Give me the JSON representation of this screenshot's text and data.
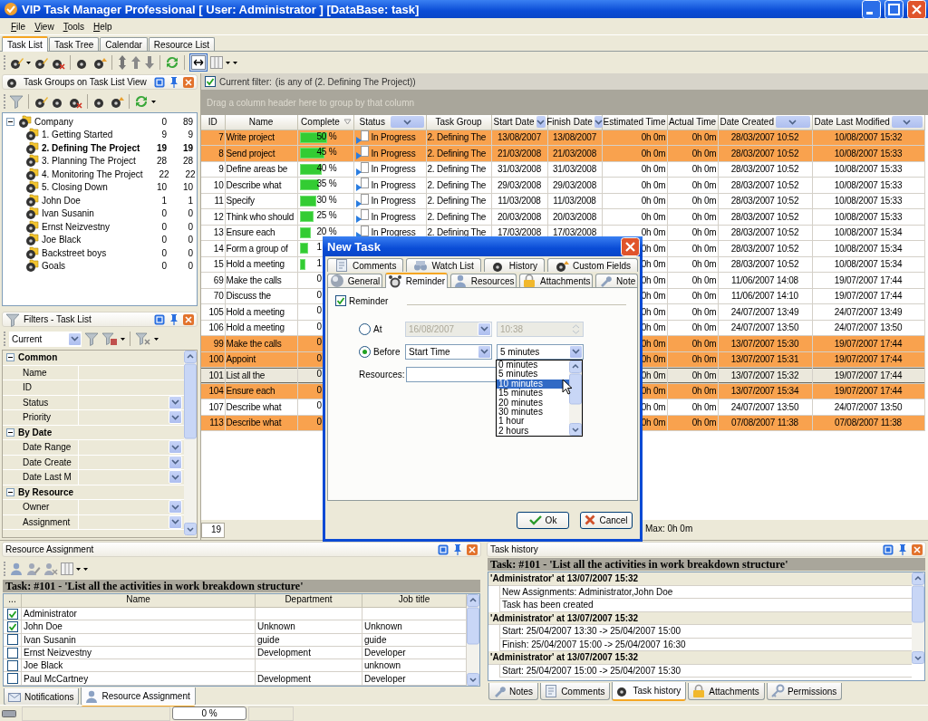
{
  "window": {
    "title": "VIP Task Manager Professional [ User: Administrator ] [DataBase: task]"
  },
  "menu": [
    "File",
    "View",
    "Tools",
    "Help"
  ],
  "tabs": [
    {
      "label": "Task List",
      "selected": true
    },
    {
      "label": "Task Tree",
      "selected": false
    },
    {
      "label": "Calendar",
      "selected": false
    },
    {
      "label": "Resource List",
      "selected": false
    }
  ],
  "task_groups": {
    "title": "Task Groups on Task List View",
    "tree": [
      {
        "label": "Company",
        "count_1": "0",
        "count_2": "89",
        "selected": false,
        "expanded": true,
        "children": [
          {
            "label": "1. Getting Started",
            "count_1": "9",
            "count_2": "9",
            "selected": false
          },
          {
            "label": "2. Defining The Project",
            "count_1": "19",
            "count_2": "19",
            "selected": true
          },
          {
            "label": "3. Planning The Project",
            "count_1": "28",
            "count_2": "28",
            "selected": false
          },
          {
            "label": "4. Monitoring The Project",
            "count_1": "22",
            "count_2": "22",
            "selected": false
          },
          {
            "label": "5. Closing Down",
            "count_1": "10",
            "count_2": "10",
            "selected": false
          },
          {
            "label": "John Doe",
            "count_1": "1",
            "count_2": "1",
            "selected": false
          },
          {
            "label": "Ivan Susanin",
            "count_1": "0",
            "count_2": "0",
            "selected": false
          },
          {
            "label": "Ernst Neizvestny",
            "count_1": "0",
            "count_2": "0",
            "selected": false
          },
          {
            "label": "Joe Black",
            "count_1": "0",
            "count_2": "0",
            "selected": false
          },
          {
            "label": "Backstreet boys",
            "count_1": "0",
            "count_2": "0",
            "selected": false
          },
          {
            "label": "Goals",
            "count_1": "0",
            "count_2": "0",
            "selected": false
          }
        ]
      }
    ]
  },
  "filters": {
    "title": "Filters - Task List",
    "preset": "Current",
    "categories": [
      {
        "label": "Common",
        "expanded": true,
        "fields": [
          {
            "label": "Name",
            "kind": "text"
          },
          {
            "label": "ID",
            "kind": "text"
          },
          {
            "label": "Status",
            "kind": "dropdown"
          },
          {
            "label": "Priority",
            "kind": "dropdown"
          }
        ]
      },
      {
        "label": "By Date",
        "expanded": true,
        "fields": [
          {
            "label": "Date Range",
            "kind": "dropdown"
          },
          {
            "label": "Date Create",
            "kind": "dropdown"
          },
          {
            "label": "Date Last M",
            "kind": "dropdown"
          }
        ]
      },
      {
        "label": "By Resource",
        "expanded": true,
        "fields": [
          {
            "label": "Owner",
            "kind": "dropdown"
          },
          {
            "label": "Assignment",
            "kind": "dropdown"
          }
        ]
      }
    ]
  },
  "task_list": {
    "filter": {
      "checked": true,
      "label": "Current filter:",
      "value": "(is any of (2. Defining The Project))"
    },
    "group_hint": "Drag a column header here to group by that column",
    "columns": [
      {
        "label": "ID",
        "kind": "plain"
      },
      {
        "label": "Name",
        "kind": "plain"
      },
      {
        "label": "Complete",
        "kind": "sort"
      },
      {
        "label": "Status",
        "kind": "dropdown"
      },
      {
        "label": "Task Group",
        "kind": "plain"
      },
      {
        "label": "Start Date",
        "kind": "dropdown"
      },
      {
        "label": "Finish Date",
        "kind": "dropdown"
      },
      {
        "label": "Estimated Time",
        "kind": "plain"
      },
      {
        "label": "Actual Time",
        "kind": "plain"
      },
      {
        "label": "Date Created",
        "kind": "dropdown"
      },
      {
        "label": "Date Last Modified",
        "kind": "dropdown"
      }
    ],
    "rows": [
      {
        "id": "7",
        "name": "Write project",
        "complete": "50 %",
        "level": 0.5,
        "status": "In Progress",
        "task_group": "2. Defining The",
        "start_date": "13/08/2007",
        "finish_date": "13/08/2007",
        "estimated_time": "0h 0m",
        "actual_time": "0h 0m",
        "date_created": "28/03/2007 10:52",
        "date_last_modified": "10/08/2007 15:32",
        "color": "#f9a24e",
        "selected": false
      },
      {
        "id": "8",
        "name": "Send project",
        "complete": "45 %",
        "level": 0.45,
        "status": "In Progress",
        "task_group": "2. Defining The",
        "start_date": "21/03/2008",
        "finish_date": "21/03/2008",
        "estimated_time": "0h 0m",
        "actual_time": "0h 0m",
        "date_created": "28/03/2007 10:52",
        "date_last_modified": "10/08/2007 15:33",
        "color": "#f9a24e",
        "selected": false
      },
      {
        "id": "9",
        "name": "Define areas be",
        "complete": "40 %",
        "level": 0.4,
        "status": "In Progress",
        "task_group": "2. Defining The",
        "start_date": "31/03/2008",
        "finish_date": "31/03/2008",
        "estimated_time": "0h 0m",
        "actual_time": "0h 0m",
        "date_created": "28/03/2007 10:52",
        "date_last_modified": "10/08/2007 15:33",
        "color": "#ffffff",
        "selected": false
      },
      {
        "id": "10",
        "name": "Describe what",
        "complete": "35 %",
        "level": 0.35,
        "status": "In Progress",
        "task_group": "2. Defining The",
        "start_date": "29/03/2008",
        "finish_date": "29/03/2008",
        "estimated_time": "0h 0m",
        "actual_time": "0h 0m",
        "date_created": "28/03/2007 10:52",
        "date_last_modified": "10/08/2007 15:33",
        "color": "#ffffff",
        "selected": false
      },
      {
        "id": "11",
        "name": "Specify",
        "complete": "30 %",
        "level": 0.3,
        "status": "In Progress",
        "task_group": "2. Defining The",
        "start_date": "11/03/2008",
        "finish_date": "11/03/2008",
        "estimated_time": "0h 0m",
        "actual_time": "0h 0m",
        "date_created": "28/03/2007 10:52",
        "date_last_modified": "10/08/2007 15:33",
        "color": "#ffffff",
        "selected": false
      },
      {
        "id": "12",
        "name": "Think who should",
        "complete": "25 %",
        "level": 0.25,
        "status": "In Progress",
        "task_group": "2. Defining The",
        "start_date": "20/03/2008",
        "finish_date": "20/03/2008",
        "estimated_time": "0h 0m",
        "actual_time": "0h 0m",
        "date_created": "28/03/2007 10:52",
        "date_last_modified": "10/08/2007 15:33",
        "color": "#ffffff",
        "selected": false
      },
      {
        "id": "13",
        "name": "Ensure each",
        "complete": "20 %",
        "level": 0.2,
        "status": "In Progress",
        "task_group": "2. Defining The",
        "start_date": "17/03/2008",
        "finish_date": "17/03/2008",
        "estimated_time": "0h 0m",
        "actual_time": "0h 0m",
        "date_created": "28/03/2007 10:52",
        "date_last_modified": "10/08/2007 15:34",
        "color": "#ffffff",
        "selected": false
      },
      {
        "id": "14",
        "name": "Form a group of",
        "complete": "1",
        "level": 0.15,
        "estimated_time": "0h 0m",
        "actual_time": "0h 0m",
        "date_created": "28/03/2007 10:52",
        "date_last_modified": "10/08/2007 15:34",
        "color": "#ffffff",
        "selected": false
      },
      {
        "id": "15",
        "name": "Hold a meeting",
        "complete": "1",
        "level": 0.1,
        "estimated_time": "0h 0m",
        "actual_time": "0h 0m",
        "date_created": "28/03/2007 10:52",
        "date_last_modified": "10/08/2007 15:34",
        "color": "#ffffff",
        "selected": false
      },
      {
        "id": "69",
        "name": "Make the calls",
        "complete": "0",
        "level": 0,
        "estimated_time": "0h 0m",
        "actual_time": "0h 0m",
        "date_created": "11/06/2007 14:08",
        "date_last_modified": "19/07/2007 17:44",
        "color": "#ffffff",
        "selected": false
      },
      {
        "id": "70",
        "name": "Discuss the",
        "complete": "0",
        "level": 0,
        "estimated_time": "0h 0m",
        "actual_time": "0h 0m",
        "date_created": "11/06/2007 14:10",
        "date_last_modified": "19/07/2007 17:44",
        "color": "#ffffff",
        "selected": false
      },
      {
        "id": "105",
        "name": "Hold a meeting",
        "complete": "0",
        "level": 0,
        "estimated_time": "0h 0m",
        "actual_time": "0h 0m",
        "date_created": "24/07/2007 13:49",
        "date_last_modified": "24/07/2007 13:49",
        "color": "#ffffff",
        "selected": false
      },
      {
        "id": "106",
        "name": "Hold a meeting",
        "complete": "0",
        "level": 0,
        "estimated_time": "0h 0m",
        "actual_time": "0h 0m",
        "date_created": "24/07/2007 13:50",
        "date_last_modified": "24/07/2007 13:50",
        "color": "#ffffff",
        "selected": false
      },
      {
        "id": "99",
        "name": "Make the calls",
        "complete": "0",
        "level": 0,
        "estimated_time": "0h 0m",
        "actual_time": "0h 0m",
        "date_created": "13/07/2007 15:30",
        "date_last_modified": "19/07/2007 17:44",
        "color": "#f9a24e",
        "selected": false
      },
      {
        "id": "100",
        "name": "Appoint",
        "complete": "0",
        "level": 0,
        "estimated_time": "0h 0m",
        "actual_time": "0h 0m",
        "date_created": "13/07/2007 15:31",
        "date_last_modified": "19/07/2007 17:44",
        "color": "#f9a24e",
        "selected": false
      },
      {
        "id": "101",
        "name": "List all the",
        "complete": "0",
        "level": 0,
        "estimated_time": "0h 0m",
        "actual_time": "0h 0m",
        "date_created": "13/07/2007 15:32",
        "date_last_modified": "19/07/2007 17:44",
        "color": "#ebe8dc",
        "selected": true
      },
      {
        "id": "104",
        "name": "Ensure each",
        "complete": "0",
        "level": 0,
        "estimated_time": "0h 0m",
        "actual_time": "0h 0m",
        "date_created": "13/07/2007 15:34",
        "date_last_modified": "19/07/2007 17:44",
        "color": "#f9a24e",
        "selected": false
      },
      {
        "id": "107",
        "name": "Describe what",
        "complete": "0",
        "level": 0,
        "estimated_time": "0h 0m",
        "actual_time": "0h 0m",
        "date_created": "24/07/2007 13:50",
        "date_last_modified": "24/07/2007 13:50",
        "color": "#ffffff",
        "selected": false
      },
      {
        "id": "113",
        "name": "Describe what",
        "complete": "0",
        "level": 0,
        "estimated_time": "0h 0m",
        "actual_time": "0h 0m",
        "date_created": "07/08/2007 11:38",
        "date_last_modified": "07/08/2007 11:38",
        "color": "#f9a24e",
        "selected": false
      }
    ],
    "footer": {
      "count": "19",
      "estimated_time": "Max: 0h 0m"
    }
  },
  "dialog": {
    "title": "New Task",
    "tab_rows": [
      [
        {
          "label": "Comments",
          "selected": false
        },
        {
          "label": "Watch List",
          "selected": false
        },
        {
          "label": "History",
          "selected": false
        },
        {
          "label": "Custom Fields",
          "selected": false
        }
      ],
      [
        {
          "label": "General",
          "selected": false
        },
        {
          "label": "Reminder",
          "selected": true
        },
        {
          "label": "Resources",
          "selected": false
        },
        {
          "label": "Attachments",
          "selected": false
        },
        {
          "label": "Note",
          "selected": false
        }
      ]
    ],
    "reminder": {
      "label": "Reminder",
      "checked": true
    },
    "at": {
      "label": "At",
      "selected": false,
      "disabled": true,
      "date": "16/08/2007",
      "time": "10:38"
    },
    "before": {
      "label": "Before",
      "selected": true,
      "relative_to": "Start Time",
      "offset": "5 minutes"
    },
    "resources_label": "Resources:",
    "offset_list": [
      {
        "label": "0 minutes",
        "selected": false
      },
      {
        "label": "5 minutes",
        "selected": false
      },
      {
        "label": "10 minutes",
        "selected": true
      },
      {
        "label": "15 minutes",
        "selected": false
      },
      {
        "label": "20 minutes",
        "selected": false
      },
      {
        "label": "30 minutes",
        "selected": false
      },
      {
        "label": "1 hour",
        "selected": false
      },
      {
        "label": "2 hours",
        "selected": false
      }
    ],
    "buttons": [
      {
        "label": "Ok",
        "kind": "ok"
      },
      {
        "label": "Cancel",
        "kind": "cancel"
      }
    ]
  },
  "resource_assignment": {
    "title": "Resource Assignment",
    "task": "Task: #101 - 'List all the activities in work breakdown structure'",
    "columns": [
      "...",
      "Name",
      "Department",
      "Job title"
    ],
    "rows": [
      {
        "checked": true,
        "name": "Administrator"
      },
      {
        "checked": true,
        "name": "John Doe",
        "department": "Unknown",
        "job_title": "Unknown"
      },
      {
        "checked": false,
        "name": "Ivan Susanin",
        "department": "guide",
        "job_title": "guide"
      },
      {
        "checked": false,
        "name": "Ernst Neizvestny",
        "department": "Development",
        "job_title": "Developer"
      },
      {
        "checked": false,
        "name": "Joe Black",
        "job_title": "unknown"
      },
      {
        "checked": false,
        "name": "Paul McCartney",
        "department": "Development",
        "job_title": "Developer"
      }
    ],
    "tabs": [
      {
        "label": "Notifications",
        "selected": false
      },
      {
        "label": "Resource Assignment",
        "selected": true
      }
    ]
  },
  "task_history": {
    "title": "Task history",
    "task": "Task: #101 - 'List all the activities in work breakdown structure'",
    "entries": [
      {
        "header": "'Administrator' at 13/07/2007 15:32",
        "lines": [
          "New Assignments: Administrator,John Doe",
          "Task has been created"
        ]
      },
      {
        "header": "'Administrator' at 13/07/2007 15:32",
        "lines": [
          "Start: 25/04/2007 13:30 -> 25/04/2007 15:00",
          "Finish: 25/04/2007 15:00 -> 25/04/2007 16:30"
        ]
      },
      {
        "header": "'Administrator' at 13/07/2007 15:32",
        "lines": [
          "Start: 25/04/2007 15:00 -> 25/04/2007 15:30"
        ]
      }
    ],
    "tabs": [
      {
        "label": "Notes",
        "selected": false
      },
      {
        "label": "Comments",
        "selected": false
      },
      {
        "label": "Task history",
        "selected": true
      },
      {
        "label": "Attachments",
        "selected": false
      },
      {
        "label": "Permissions",
        "selected": false
      }
    ]
  },
  "status_bar": {
    "progress": "0 %",
    "level": 0
  }
}
